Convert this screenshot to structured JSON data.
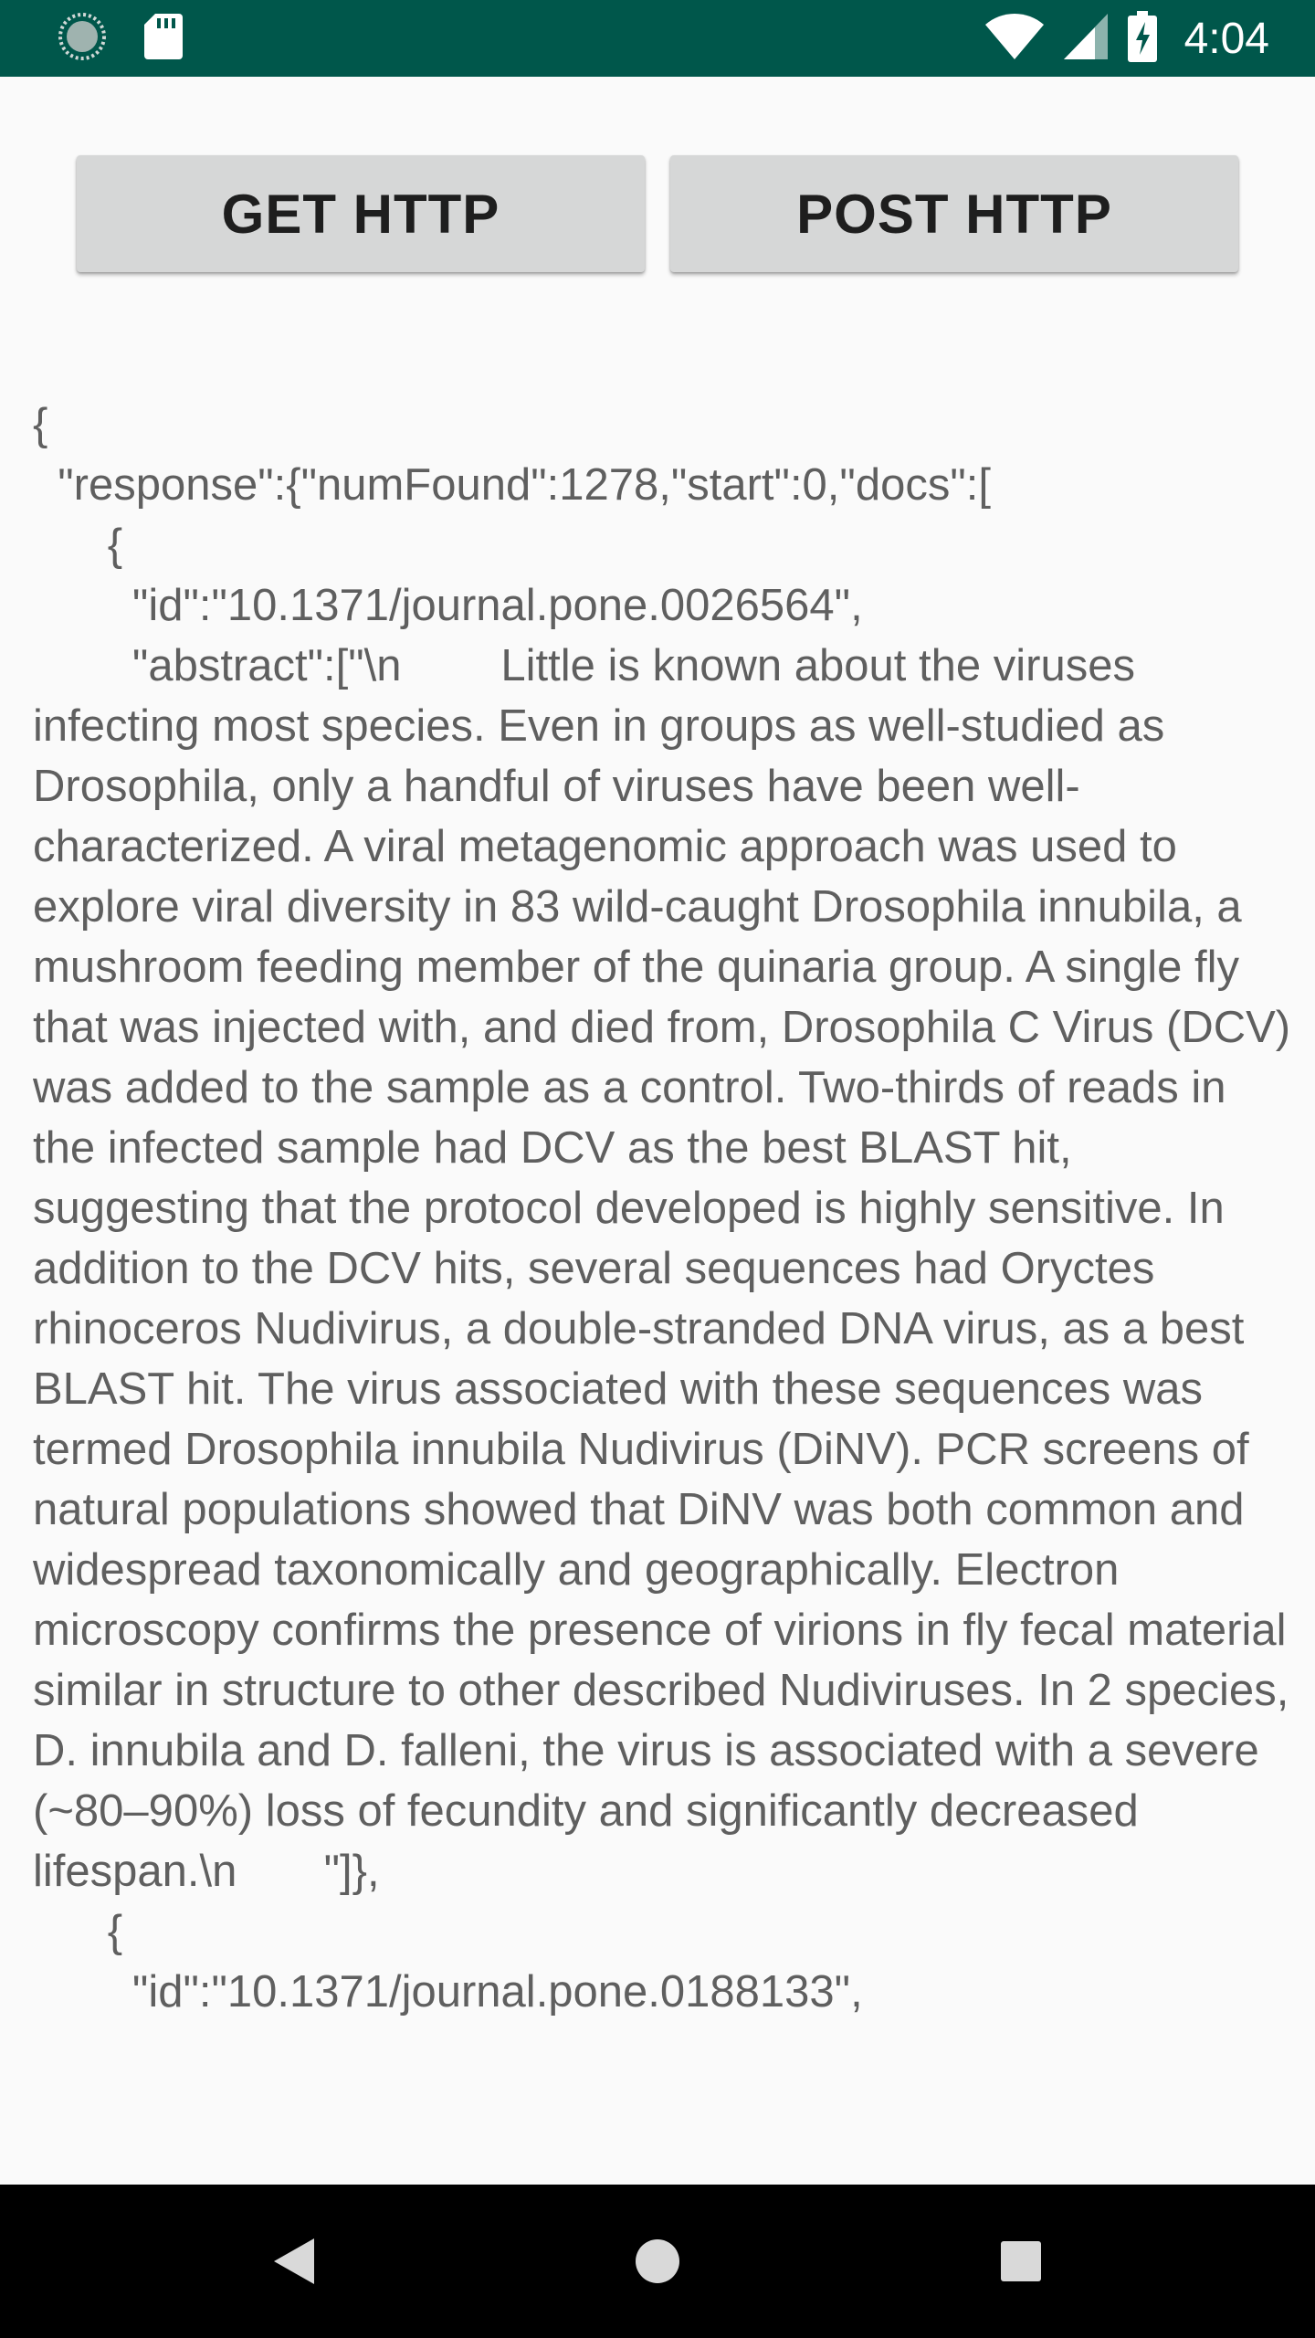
{
  "status_bar": {
    "time": "4:04",
    "icons": [
      "sync-icon",
      "sd-card-icon",
      "wifi-icon",
      "cell-signal-icon",
      "battery-charging-icon"
    ]
  },
  "buttons": {
    "get_label": "GET HTTP",
    "post_label": "POST HTTP"
  },
  "response": {
    "text": "{\n  \"response\":{\"numFound\":1278,\"start\":0,\"docs\":[\n      {\n        \"id\":\"10.1371/journal.pone.0026564\",\n        \"abstract\":[\"\\n        Little is known about the viruses infecting most species. Even in groups as well-studied as Drosophila, only a handful of viruses have been well-characterized. A viral metagenomic approach was used to explore viral diversity in 83 wild-caught Drosophila innubila, a mushroom feeding member of the quinaria group. A single fly that was injected with, and died from, Drosophila C Virus (DCV) was added to the sample as a control. Two-thirds of reads in the infected sample had DCV as the best BLAST hit, suggesting that the protocol developed is highly sensitive. In addition to the DCV hits, several sequences had Oryctes rhinoceros Nudivirus, a double-stranded DNA virus, as a best BLAST hit. The virus associated with these sequences was termed Drosophila innubila Nudivirus (DiNV). PCR screens of natural populations showed that DiNV was both common and widespread taxonomically and geographically. Electron microscopy confirms the presence of virions in fly fecal material similar in structure to other described Nudiviruses. In 2 species, D. innubila and D. falleni, the virus is associated with a severe (~80–90%) loss of fecundity and significantly decreased lifespan.\\n       \"]},\n      {\n        \"id\":\"10.1371/journal.pone.0188133\","
  },
  "nav_bar": {
    "icons": [
      "back-icon",
      "home-icon",
      "recents-icon"
    ]
  }
}
